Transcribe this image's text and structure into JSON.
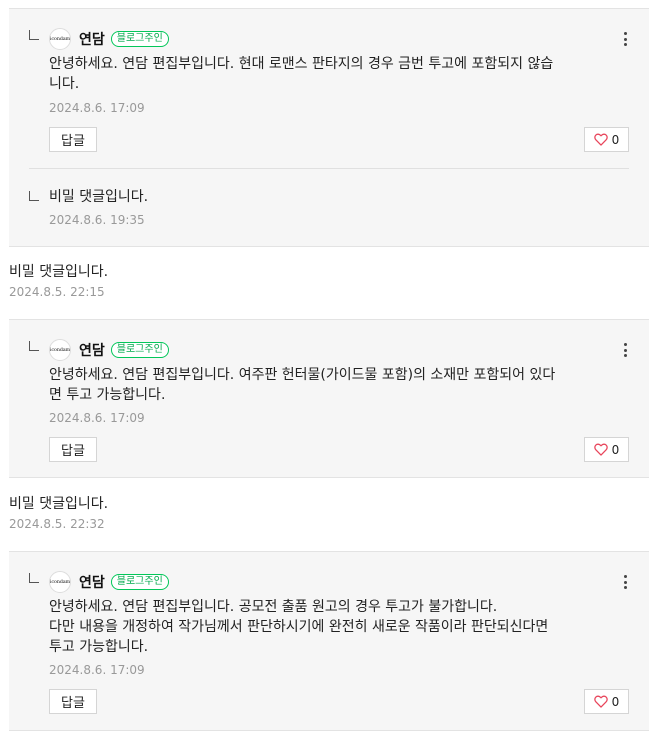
{
  "blog": {
    "owner_badge": "블로그주인",
    "avatar_text": "icondam"
  },
  "buttons": {
    "reply_label": "답글"
  },
  "threads": [
    {
      "replies": [
        {
          "author": "연담",
          "text": "안녕하세요. 연담 편집부입니다. 현대 로맨스 판타지의 경우 금번 투고에 포함되지 않습\n니다.",
          "date": "2024.8.6. 17:09",
          "likes": "0"
        },
        {
          "text": "비밀 댓글입니다.",
          "date": "2024.8.6. 19:35"
        }
      ]
    },
    {
      "comment": {
        "text": "비밀 댓글입니다.",
        "date": "2024.8.5. 22:15"
      },
      "replies": [
        {
          "author": "연담",
          "text": "안녕하세요. 연담 편집부입니다. 여주판 헌터물(가이드물 포함)의 소재만 포함되어 있다\n면 투고 가능합니다.",
          "date": "2024.8.6. 17:09",
          "likes": "0"
        }
      ]
    },
    {
      "comment": {
        "text": "비밀 댓글입니다.",
        "date": "2024.8.5. 22:32"
      },
      "replies": [
        {
          "author": "연담",
          "text": "안녕하세요. 연담 편집부입니다. 공모전 출품 원고의 경우 투고가 불가합니다.\n다만 내용을 개정하여 작가님께서 판단하시기에 완전히 새로운 작품이라 판단되신다면\n투고 가능합니다.",
          "date": "2024.8.6. 17:09",
          "likes": "0"
        }
      ]
    }
  ]
}
